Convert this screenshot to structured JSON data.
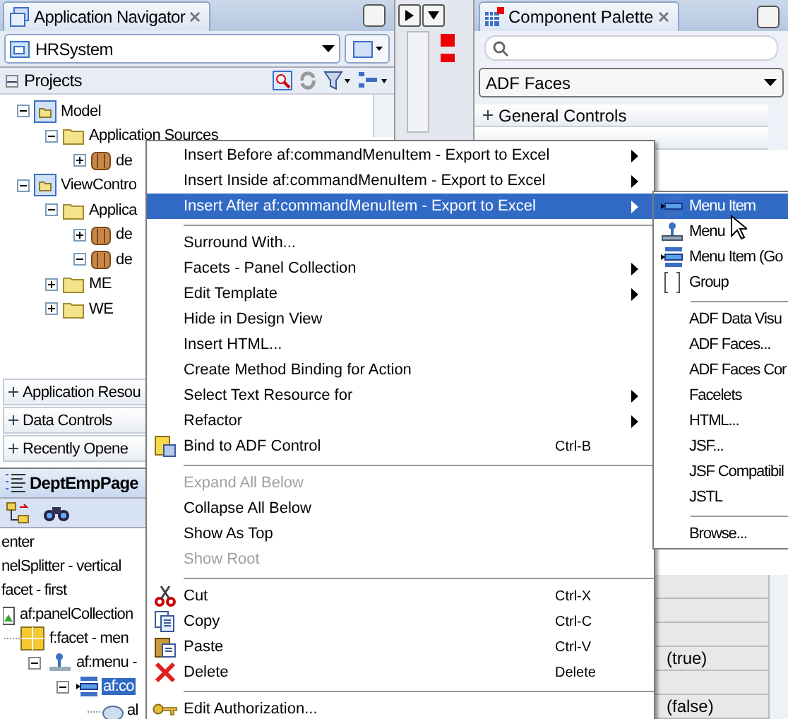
{
  "navigator": {
    "title": "Application Navigator",
    "application": "HRSystem",
    "projects_header": "Projects",
    "tree": [
      {
        "label": "Model",
        "kind": "project",
        "expanded": true,
        "children": [
          {
            "label": "Application Sources",
            "kind": "folder",
            "expanded": true,
            "children": [
              {
                "label": "de",
                "kind": "package",
                "expanded": false
              }
            ]
          }
        ]
      },
      {
        "label": "ViewContro",
        "kind": "project",
        "expanded": true,
        "children": [
          {
            "label": "Applica",
            "kind": "folder",
            "expanded": true,
            "children": [
              {
                "label": "de",
                "kind": "package",
                "expanded": false
              },
              {
                "label": "de",
                "kind": "package",
                "expanded": true
              }
            ]
          },
          {
            "label": "ME",
            "kind": "folder",
            "expanded": false
          },
          {
            "label": "WE",
            "kind": "folder",
            "expanded": false
          }
        ]
      }
    ],
    "sections": [
      "Application Resou",
      "Data Controls",
      "Recently Opene"
    ]
  },
  "structure": {
    "title": "DeptEmpPage",
    "tree": [
      {
        "label": "enter",
        "selected": false,
        "children": [
          {
            "label": "nelSplitter - vertical",
            "selected": false,
            "children": [
              {
                "label": "facet - first",
                "selected": false,
                "children": [
                  {
                    "label": "af:panelCollection",
                    "selected": false,
                    "children": [
                      {
                        "label": "f:facet - men",
                        "selected": false,
                        "children": [
                          {
                            "label": "af:menu -",
                            "selected": false,
                            "children": [
                              {
                                "label": "af:co",
                                "selected": true,
                                "children": [
                                  {
                                    "label": "al",
                                    "selected": false
                                  }
                                ]
                              }
                            ]
                          }
                        ]
                      }
                    ]
                  }
                ]
              }
            ]
          }
        ]
      }
    ]
  },
  "palette": {
    "title": "Component Palette",
    "library": "ADF Faces",
    "sections": [
      "General Controls"
    ],
    "properties": [
      "(true)",
      "(false)"
    ]
  },
  "context_menu": {
    "items": [
      {
        "kind": "item",
        "label": "Insert Before af:commandMenuItem - Export to Excel",
        "submenu": true,
        "selected": false,
        "disabled": false
      },
      {
        "kind": "item",
        "label": "Insert Inside af:commandMenuItem - Export to Excel",
        "submenu": true,
        "selected": false,
        "disabled": false
      },
      {
        "kind": "item",
        "label": "Insert After af:commandMenuItem - Export to Excel",
        "submenu": true,
        "selected": true,
        "disabled": false
      },
      {
        "kind": "separator"
      },
      {
        "kind": "item",
        "label": "Surround With...",
        "selected": false,
        "disabled": false
      },
      {
        "kind": "item",
        "label": "Facets - Panel Collection",
        "submenu": true,
        "selected": false,
        "disabled": false
      },
      {
        "kind": "item",
        "label": "Edit Template",
        "submenu": true,
        "selected": false,
        "disabled": false
      },
      {
        "kind": "item",
        "label": "Hide in Design View",
        "selected": false,
        "disabled": false
      },
      {
        "kind": "item",
        "label": "Insert HTML...",
        "selected": false,
        "disabled": false
      },
      {
        "kind": "item",
        "label": "Create Method Binding for Action",
        "selected": false,
        "disabled": false
      },
      {
        "kind": "item",
        "label": "Select Text Resource for",
        "submenu": true,
        "selected": false,
        "disabled": false
      },
      {
        "kind": "item",
        "label": "Refactor",
        "submenu": true,
        "selected": false,
        "disabled": false
      },
      {
        "kind": "item",
        "label": "Bind to ADF Control",
        "shortcut": "Ctrl-B",
        "selected": false,
        "disabled": false
      },
      {
        "kind": "separator"
      },
      {
        "kind": "item",
        "label": "Expand All Below",
        "selected": false,
        "disabled": true
      },
      {
        "kind": "item",
        "label": "Collapse All Below",
        "selected": false,
        "disabled": false
      },
      {
        "kind": "item",
        "label": "Show As Top",
        "selected": false,
        "disabled": false
      },
      {
        "kind": "item",
        "label": "Show Root",
        "selected": false,
        "disabled": true
      },
      {
        "kind": "separator"
      },
      {
        "kind": "item",
        "label": "Cut",
        "shortcut": "Ctrl-X",
        "selected": false,
        "disabled": false
      },
      {
        "kind": "item",
        "label": "Copy",
        "shortcut": "Ctrl-C",
        "selected": false,
        "disabled": false
      },
      {
        "kind": "item",
        "label": "Paste",
        "shortcut": "Ctrl-V",
        "selected": false,
        "disabled": false
      },
      {
        "kind": "item",
        "label": "Delete",
        "shortcut": "Delete",
        "selected": false,
        "disabled": false
      },
      {
        "kind": "separator"
      },
      {
        "kind": "item",
        "label": "Edit Authorization...",
        "selected": false,
        "disabled": false
      }
    ]
  },
  "submenu": {
    "items": [
      {
        "kind": "item",
        "label": "Menu Item",
        "selected": true
      },
      {
        "kind": "item",
        "label": "Menu",
        "selected": false
      },
      {
        "kind": "item",
        "label": "Menu Item (Go",
        "selected": false
      },
      {
        "kind": "item",
        "label": "Group",
        "selected": false
      },
      {
        "kind": "separator"
      },
      {
        "kind": "item",
        "label": "ADF Data Visu",
        "selected": false
      },
      {
        "kind": "item",
        "label": "ADF Faces...",
        "selected": false
      },
      {
        "kind": "item",
        "label": "ADF Faces Cor",
        "selected": false
      },
      {
        "kind": "item",
        "label": "Facelets",
        "selected": false
      },
      {
        "kind": "item",
        "label": "HTML...",
        "selected": false
      },
      {
        "kind": "item",
        "label": "JSF...",
        "selected": false
      },
      {
        "kind": "item",
        "label": "JSF Compatibil",
        "selected": false
      },
      {
        "kind": "item",
        "label": "JSTL",
        "selected": false
      },
      {
        "kind": "separator"
      },
      {
        "kind": "item",
        "label": "Browse...",
        "selected": false
      }
    ]
  }
}
